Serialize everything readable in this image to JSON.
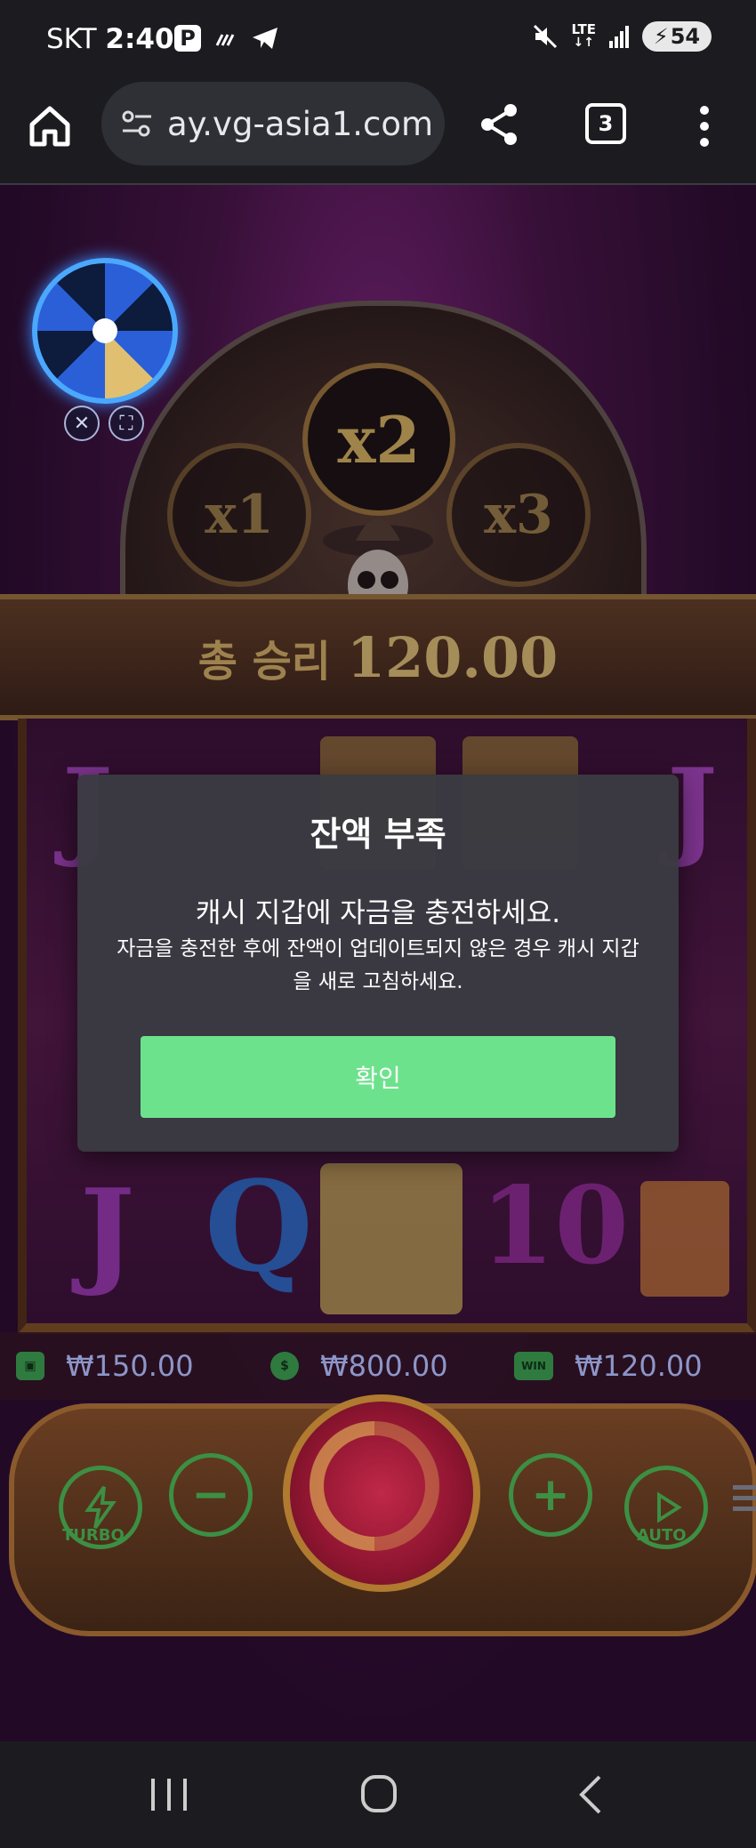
{
  "status_bar": {
    "carrier": "SKT",
    "time": "2:40",
    "p_badge": "P",
    "network": "LTE",
    "battery": "54"
  },
  "browser": {
    "url": "ay.vg-asia1.com",
    "tab_count": "3"
  },
  "game": {
    "multipliers": [
      "x1",
      "x2",
      "x3"
    ],
    "total_win_label": "총 승리",
    "total_win_value": "120.00",
    "info": {
      "bet": "₩150.00",
      "balance": "₩800.00",
      "win_icon": "WIN",
      "win": "₩120.00"
    },
    "controls": {
      "turbo_label": "TURBO",
      "auto_label": "AUTO",
      "minus": "−",
      "plus": "+"
    },
    "reel_symbols_visible": [
      "J",
      "Q",
      "10",
      "J",
      "J"
    ]
  },
  "modal": {
    "title": "잔액 부족",
    "line1": "캐시 지갑에 자금을 충전하세요.",
    "line2": "자금을 충전한 후에 잔액이 업데이트되지 않은 경우 캐시 지갑을 새로 고침하세요.",
    "confirm_label": "확인"
  },
  "colors": {
    "confirm_button": "#6de28c",
    "modal_bg": "#3a3a42",
    "ui_green": "#3c8f43"
  }
}
